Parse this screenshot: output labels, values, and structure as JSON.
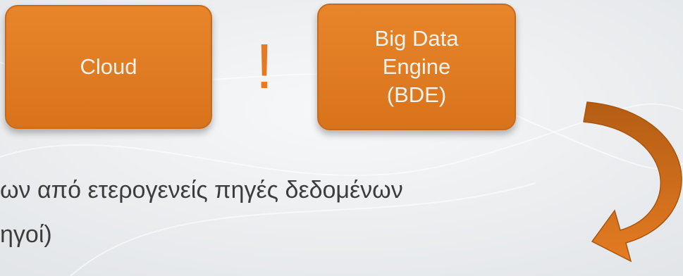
{
  "diagram": {
    "boxes": [
      {
        "label": "Cloud"
      },
      {
        "label": "Big Data\nEngine\n(BDE)"
      }
    ],
    "connector_symbol": "!",
    "colors": {
      "box_fill": "#e07d24",
      "box_border": "#c9691a",
      "box_text": "#f6f2ec",
      "accent": "#e47b22",
      "arrow": "#d8731c",
      "body_text": "#3d3d3d"
    },
    "icons": [
      "curved-arrow-icon"
    ]
  },
  "body_text": {
    "line1": "ων από ετερογενείς πηγές δεδομένων",
    "line2": "ηγοί)"
  }
}
